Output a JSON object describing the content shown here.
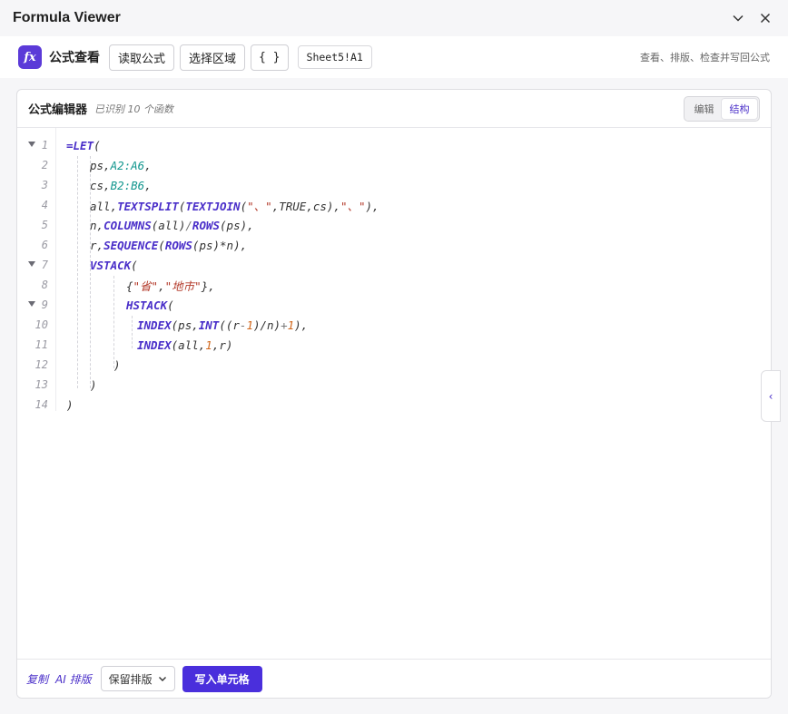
{
  "window": {
    "title": "Formula Viewer"
  },
  "toolbar": {
    "logo": "fx",
    "app_name": "公式查看",
    "read_formula": "读取公式",
    "select_range": "选择区域",
    "braces": "{ }",
    "cell_ref": "Sheet5!A1",
    "hint": "查看、排版、检查并写回公式"
  },
  "panel": {
    "title": "公式编辑器",
    "subtitle": "已识别 10 个函数",
    "modes": {
      "edit": "编辑",
      "structure": "结构",
      "active": "structure"
    }
  },
  "editor": {
    "lines": [
      {
        "n": "1",
        "fold": true
      },
      {
        "n": "2",
        "fold": false
      },
      {
        "n": "3",
        "fold": false
      },
      {
        "n": "4",
        "fold": false
      },
      {
        "n": "5",
        "fold": false
      },
      {
        "n": "6",
        "fold": false
      },
      {
        "n": "7",
        "fold": true
      },
      {
        "n": "8",
        "fold": false
      },
      {
        "n": "9",
        "fold": true
      },
      {
        "n": "10",
        "fold": false
      },
      {
        "n": "11",
        "fold": false
      },
      {
        "n": "12",
        "fold": false
      },
      {
        "n": "13",
        "fold": false
      },
      {
        "n": "14",
        "fold": false
      }
    ],
    "code": {
      "l1": {
        "eq": "=",
        "fn": "LET",
        "rest": "("
      },
      "l2": {
        "a": "ps,",
        "ref": "A2:A6",
        "b": ","
      },
      "l3": {
        "a": "cs,",
        "ref": "B2:B6",
        "b": ","
      },
      "l4": {
        "a": "all,",
        "fn1": "TEXTSPLIT",
        "b": "(",
        "fn2": "TEXTJOIN",
        "c": "(",
        "s1": "\"、\"",
        "d": ",TRUE,cs),",
        "s2": "\"、\"",
        "e": "),"
      },
      "l5": {
        "a": "n,",
        "fn1": "COLUMNS",
        "b": "(all)",
        "op": "/",
        "fn2": "ROWS",
        "c": "(ps),"
      },
      "l6": {
        "a": "r,",
        "fn1": "SEQUENCE",
        "b": "(",
        "fn2": "ROWS",
        "c": "(ps)*n),"
      },
      "l7": {
        "fn": "VSTACK",
        "rest": "("
      },
      "l8": {
        "a": "{",
        "s1": "\"省\"",
        "b": ",",
        "s2": "\"地市\"",
        "c": "},"
      },
      "l9": {
        "fn": "HSTACK",
        "rest": "("
      },
      "l10": {
        "fn1": "INDEX",
        "a": "(ps,",
        "fn2": "INT",
        "b": "((r",
        "op1": "-",
        "n1": "1",
        "c": ")/n)",
        "op2": "+",
        "n2": "1",
        "d": "),"
      },
      "l11": {
        "fn": "INDEX",
        "a": "(all,",
        "n1": "1",
        "b": ",r)"
      },
      "l12": {
        "a": ")"
      },
      "l13": {
        "a": ")"
      },
      "l14": {
        "a": ")"
      }
    }
  },
  "footer": {
    "copy": "复制",
    "ai_format": "AI 排版",
    "format_select": "保留排版",
    "write_cell": "写入单元格"
  },
  "side_toggle": {
    "glyph": "‹"
  }
}
